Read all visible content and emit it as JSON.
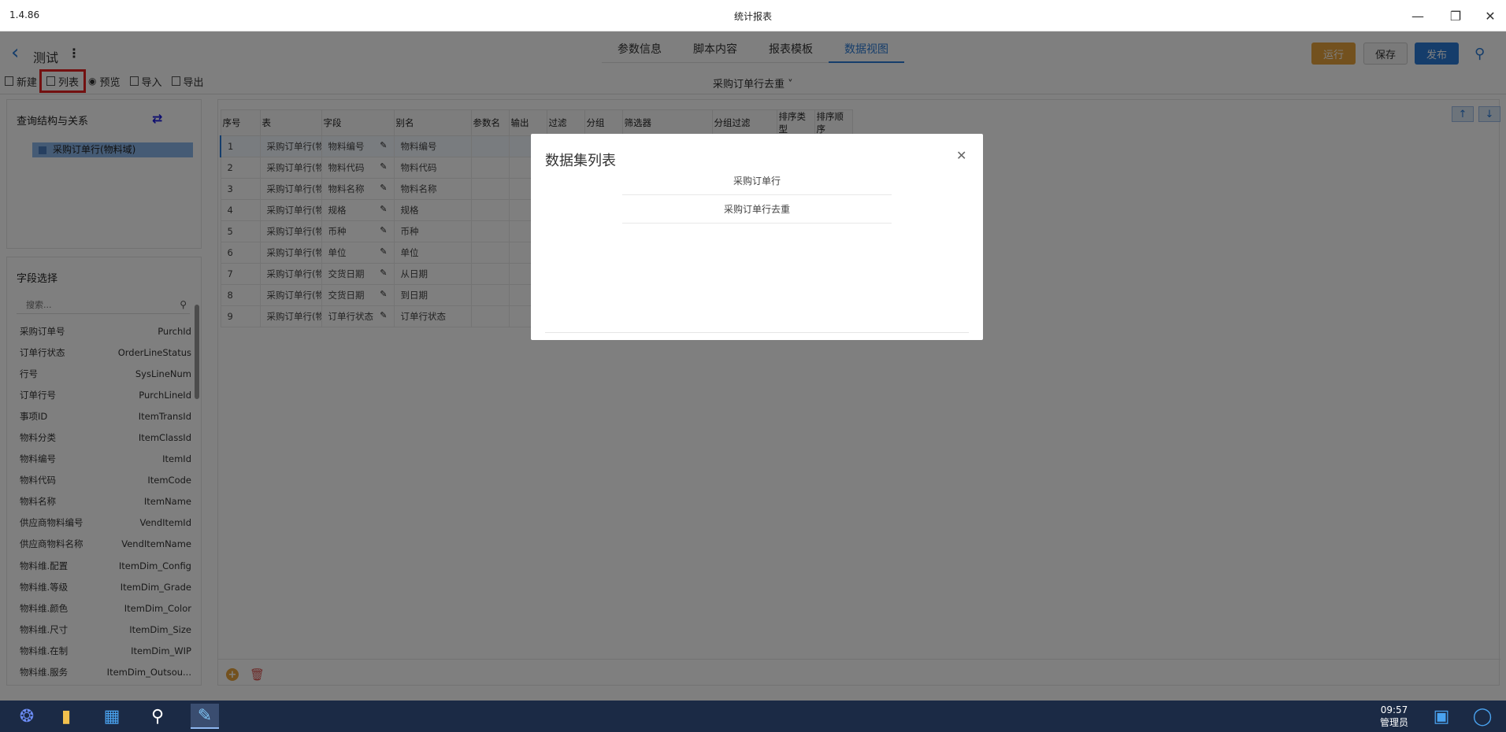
{
  "window": {
    "version": "1.4.86",
    "title": "统计报表"
  },
  "header": {
    "project_name": "测试",
    "tabs": [
      {
        "label": "参数信息"
      },
      {
        "label": "脚本内容"
      },
      {
        "label": "报表模板"
      },
      {
        "label": "数据视图",
        "active": true
      }
    ],
    "run_label": "运行",
    "save_label": "保存",
    "publish_label": "发布"
  },
  "toolbar": {
    "new_label": "新建",
    "list_label": "列表",
    "preview_label": "预览",
    "import_label": "导入",
    "export_label": "导出",
    "dataset_name": "采购订单行去重"
  },
  "left": {
    "query_title": "查询结构与关系",
    "tree_node": "采购订单行(物料域)",
    "field_title": "字段选择",
    "search_placeholder": "搜索...",
    "fields": [
      {
        "name": "采购订单号",
        "code": "PurchId"
      },
      {
        "name": "订单行状态",
        "code": "OrderLineStatus"
      },
      {
        "name": "行号",
        "code": "SysLineNum"
      },
      {
        "name": "订单行号",
        "code": "PurchLineId"
      },
      {
        "name": "事项ID",
        "code": "ItemTransId"
      },
      {
        "name": "物料分类",
        "code": "ItemClassId"
      },
      {
        "name": "物料编号",
        "code": "ItemId"
      },
      {
        "name": "物料代码",
        "code": "ItemCode"
      },
      {
        "name": "物料名称",
        "code": "ItemName"
      },
      {
        "name": "供应商物料编号",
        "code": "VendItemId"
      },
      {
        "name": "供应商物料名称",
        "code": "VendItemName"
      },
      {
        "name": "物料维.配置",
        "code": "ItemDim_Config"
      },
      {
        "name": "物料维.等级",
        "code": "ItemDim_Grade"
      },
      {
        "name": "物料维.颜色",
        "code": "ItemDim_Color"
      },
      {
        "name": "物料维.尺寸",
        "code": "ItemDim_Size"
      },
      {
        "name": "物料维.在制",
        "code": "ItemDim_WIP"
      },
      {
        "name": "物料维.服务",
        "code": "ItemDim_Outsou..."
      }
    ]
  },
  "grid": {
    "columns": [
      "序号",
      "表",
      "字段",
      "别名",
      "参数名",
      "输出",
      "过滤",
      "分组",
      "筛选器",
      "分组过滤",
      "排序类型",
      "排序顺序"
    ],
    "rows": [
      {
        "no": "1",
        "table": "采购订单行(物料",
        "field": "物料编号",
        "alias": "物料编号"
      },
      {
        "no": "2",
        "table": "采购订单行(物料",
        "field": "物料代码",
        "alias": "物料代码"
      },
      {
        "no": "3",
        "table": "采购订单行(物料",
        "field": "物料名称",
        "alias": "物料名称"
      },
      {
        "no": "4",
        "table": "采购订单行(物料",
        "field": "规格",
        "alias": "规格"
      },
      {
        "no": "5",
        "table": "采购订单行(物料",
        "field": "币种",
        "alias": "币种"
      },
      {
        "no": "6",
        "table": "采购订单行(物料",
        "field": "单位",
        "alias": "单位"
      },
      {
        "no": "7",
        "table": "采购订单行(物料",
        "field": "交货日期",
        "alias": "从日期"
      },
      {
        "no": "8",
        "table": "采购订单行(物料",
        "field": "交货日期",
        "alias": "到日期"
      },
      {
        "no": "9",
        "table": "采购订单行(物料",
        "field": "订单行状态",
        "alias": "订单行状态"
      }
    ]
  },
  "modal": {
    "title": "数据集列表",
    "items": [
      "采购订单行",
      "采购订单行去重"
    ]
  },
  "taskbar": {
    "time": "09:57",
    "user": "管理员"
  },
  "colors": {
    "accent": "#2b7bd6",
    "run": "#e6a23c",
    "highlight": "#e62020"
  }
}
